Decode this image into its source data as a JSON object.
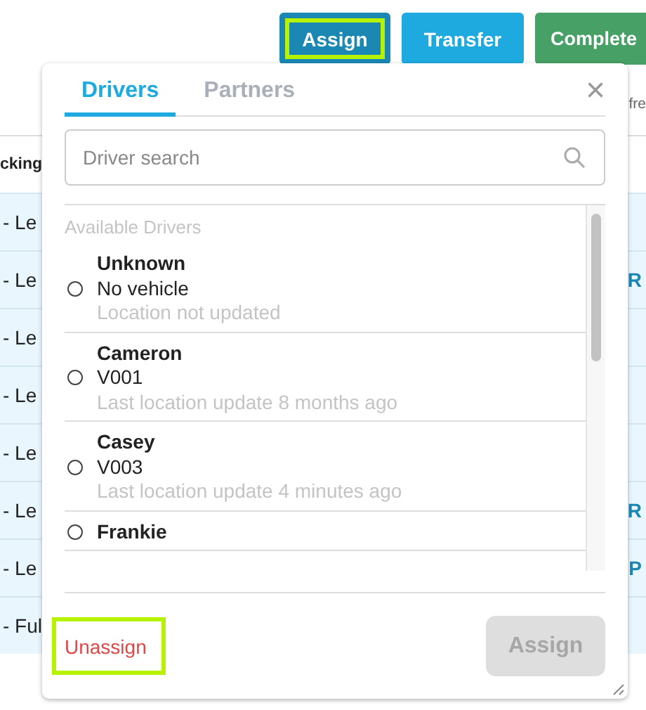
{
  "toolbar": {
    "buttons": [
      {
        "label": "Assign",
        "kind": "dark",
        "highlighted": true
      },
      {
        "label": "Transfer",
        "kind": "blue",
        "highlighted": false
      },
      {
        "label": "Complete",
        "kind": "green",
        "highlighted": false
      }
    ],
    "side_text": "fre"
  },
  "table": {
    "header": "cking",
    "rows": [
      {
        "column_1": "- Le",
        "column_2": ""
      },
      {
        "column_1": "- Le",
        "column_2": "R"
      },
      {
        "column_1": "- Le",
        "column_2": ""
      },
      {
        "column_1": "- Le",
        "column_2": ""
      },
      {
        "column_1": "- Le",
        "column_2": ""
      },
      {
        "column_1": "- Le",
        "column_2": "R"
      },
      {
        "column_1": "- Le",
        "column_2": "P"
      },
      {
        "column_1": "- Ful",
        "column_2": ""
      }
    ]
  },
  "popover": {
    "tabs": [
      {
        "label": "Drivers",
        "selected": true
      },
      {
        "label": "Partners",
        "selected": false
      }
    ],
    "close": "×",
    "search": {
      "placeholder": "Driver search"
    },
    "list_heading": "Available Drivers",
    "drivers": [
      {
        "name": "Unknown",
        "vehicle": "No vehicle",
        "location": "Location not updated",
        "selected": false
      },
      {
        "name": "Cameron",
        "vehicle": "V001",
        "location": "Last location update 8 months ago",
        "selected": false
      },
      {
        "name": "Casey",
        "vehicle": "V003",
        "location": "Last location update 4 minutes ago",
        "selected": false
      },
      {
        "name": "Frankie",
        "selected": false
      }
    ],
    "unassign": {
      "label": "Unassign",
      "highlighted": true
    },
    "assign": {
      "label": "Assign",
      "disabled": true
    }
  }
}
